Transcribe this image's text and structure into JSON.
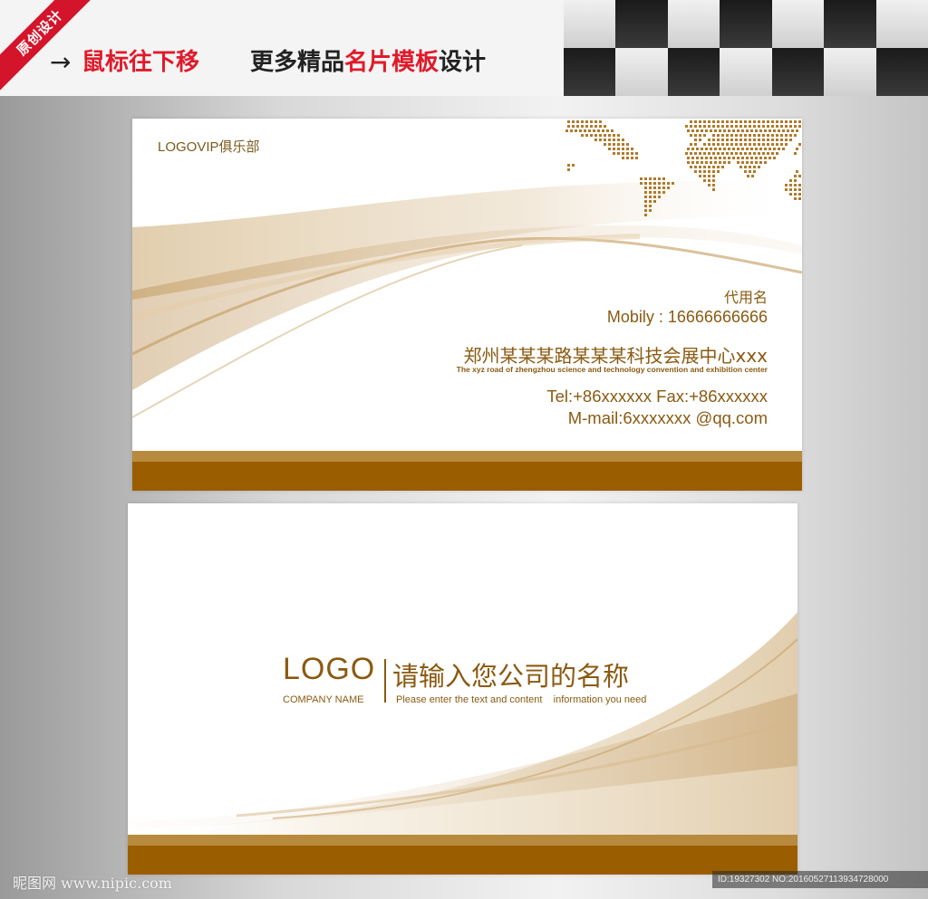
{
  "banner": {
    "ribbon_text": "原创设计",
    "arrow": "→",
    "hint_red": "鼠标往下移",
    "hint_prefix": "更多精品",
    "hint_red2": "名片模板",
    "hint_suffix": "设计"
  },
  "card_front": {
    "logo_text": "LOGOVIP俱乐部",
    "name": "代用名",
    "mobile": "Mobily : 16666666666",
    "address": "郑州某某某路某某某科技会展中心xxx",
    "address_en": "The xyz road of zhengzhou science and technology convention and exhibition center",
    "tel": "Tel:+86xxxxxx Fax:+86xxxxxx",
    "mail": "M-mail:6xxxxxxx @qq.com",
    "map_icon": "world-map-dots",
    "accent_color": "#9a5e00"
  },
  "card_back": {
    "logo": "LOGO",
    "company_name_en": "COMPANY NAME",
    "company_name_cn": "请输入您公司的名称",
    "subtitle": "Please enter the text and content    information you need"
  },
  "footer": {
    "watermark": "昵图网 www.nipic.com",
    "id_text": "ID:19327302 NO:20160527113934728000"
  }
}
